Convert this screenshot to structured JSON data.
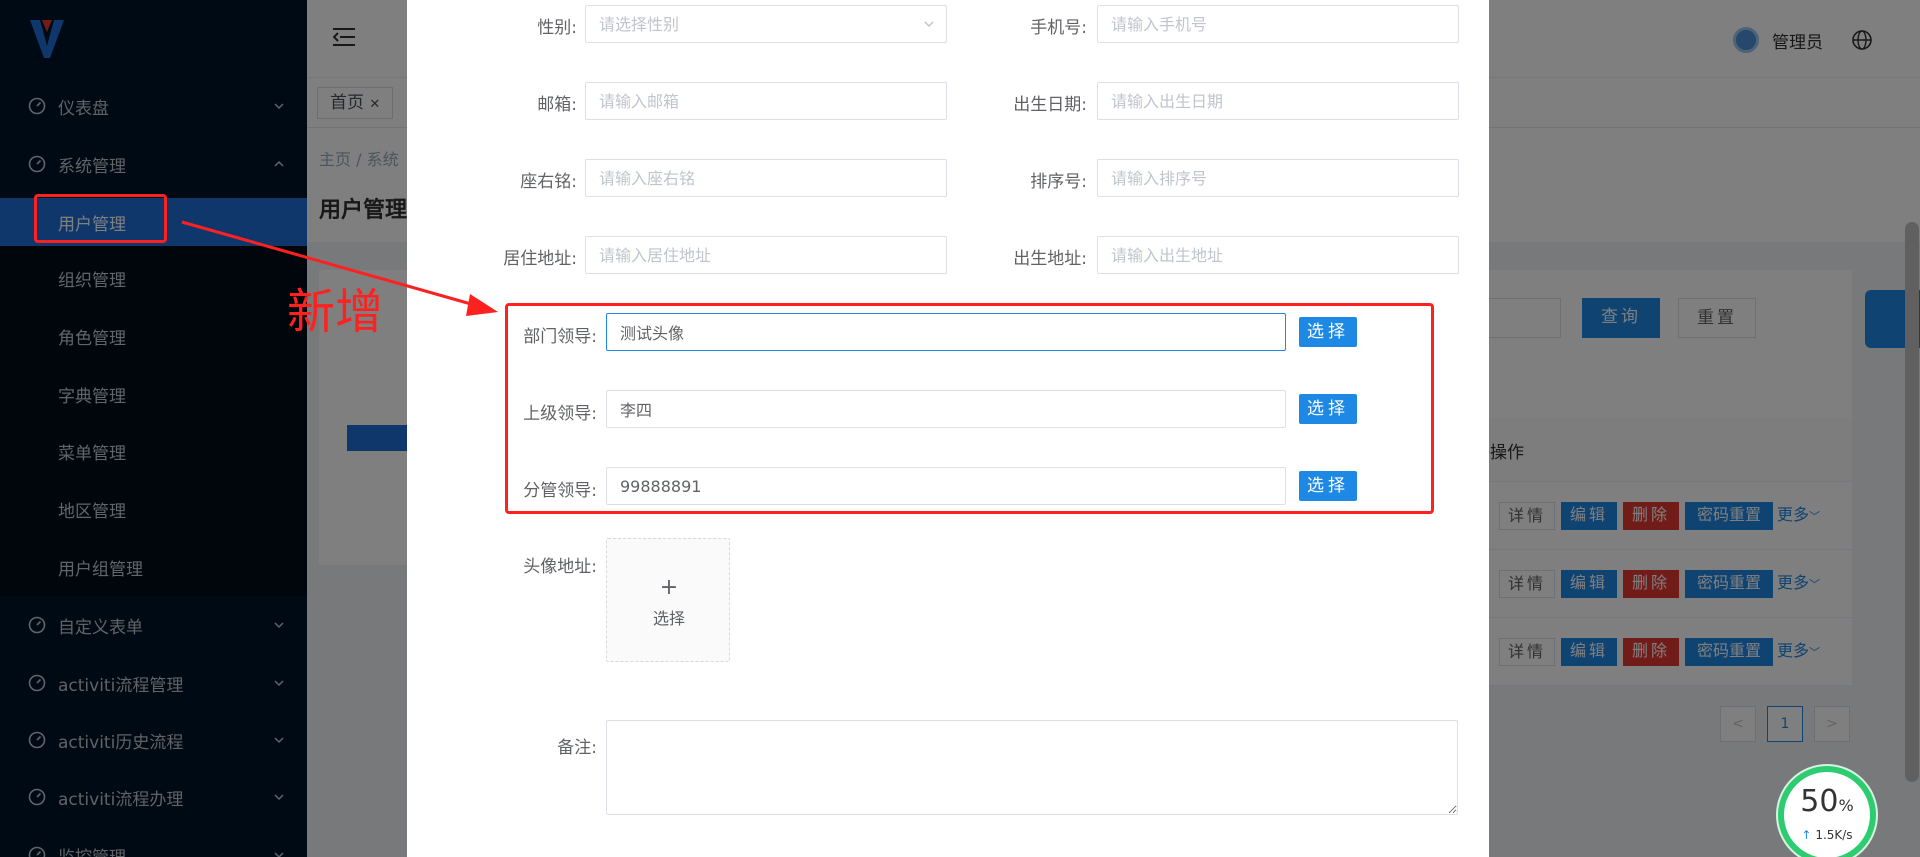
{
  "sidebar": {
    "menu": [
      {
        "label": "仪表盘",
        "icon": "dashboard-icon"
      },
      {
        "label": "系统管理",
        "icon": "dashboard-icon"
      }
    ],
    "submenu": [
      {
        "label": "用户管理"
      },
      {
        "label": "组织管理"
      },
      {
        "label": "角色管理"
      },
      {
        "label": "字典管理"
      },
      {
        "label": "菜单管理"
      },
      {
        "label": "地区管理"
      },
      {
        "label": "用户组管理"
      }
    ],
    "menu_bottom": [
      {
        "label": "自定义表单"
      },
      {
        "label": "activiti流程管理"
      },
      {
        "label": "activiti历史流程"
      },
      {
        "label": "activiti流程办理"
      },
      {
        "label": "监控管理"
      }
    ]
  },
  "navbar": {
    "username": "管理员"
  },
  "tags": {
    "home": "首页"
  },
  "background": {
    "breadcrumb": "主页 / 系统",
    "page_title": "用户管理",
    "query_button": "查询",
    "reset_button": "重置",
    "table_header_operation": "操作",
    "row_actions": {
      "detail": "详情",
      "edit": "编辑",
      "delete": "删除",
      "reset_password": "密码重置",
      "more": "更多"
    },
    "pagination": {
      "prev": "<",
      "current": "1",
      "next": ">"
    }
  },
  "form": {
    "gender": {
      "label": "性别:",
      "placeholder": "请选择性别"
    },
    "phone": {
      "label": "手机号:",
      "placeholder": "请输入手机号"
    },
    "email": {
      "label": "邮箱:",
      "placeholder": "请输入邮箱"
    },
    "birth_date": {
      "label": "出生日期:",
      "placeholder": "请输入出生日期"
    },
    "motto": {
      "label": "座右铭:",
      "placeholder": "请输入座右铭"
    },
    "sort": {
      "label": "排序号:",
      "placeholder": "请输入排序号"
    },
    "home_address": {
      "label": "居住地址:",
      "placeholder": "请输入居住地址"
    },
    "birth_place": {
      "label": "出生地址:",
      "placeholder": "请输入出生地址"
    },
    "dept_leader": {
      "label": "部门领导:",
      "value": "测试头像"
    },
    "superior": {
      "label": "上级领导:",
      "value": "李四"
    },
    "charge_leader": {
      "label": "分管领导:",
      "value": "99888891"
    },
    "choose_button": "选择",
    "avatar": {
      "label": "头像地址:",
      "plus": "+",
      "text": "选择"
    },
    "remark": {
      "label": "备注:"
    }
  },
  "annotation": {
    "text": "新增",
    "color": "#ff2020"
  },
  "speed_widget": {
    "percent": "50",
    "percent_unit": "%",
    "rate": "1.5K/s",
    "rate_arrow": "↑"
  },
  "colors": {
    "primary": "#1e88e5",
    "danger": "#e53935",
    "sidebar_bg": "#001529",
    "annotation_red": "#ff2020"
  }
}
